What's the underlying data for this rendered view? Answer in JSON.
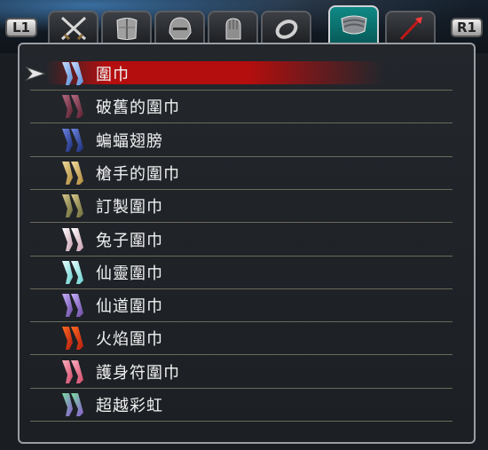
{
  "shoulder_buttons": {
    "left": "L1",
    "right": "R1"
  },
  "tabs": [
    {
      "icon": "crossed-swords-icon",
      "active": false
    },
    {
      "icon": "chest-armor-icon",
      "active": false
    },
    {
      "icon": "helmet-icon",
      "active": false
    },
    {
      "icon": "gauntlet-icon",
      "active": false
    },
    {
      "icon": "ring-icon",
      "active": false
    },
    {
      "icon": "scarf-icon",
      "active": true
    },
    {
      "icon": "crystal-wand-icon",
      "active": false
    }
  ],
  "items": [
    {
      "label": "圍巾",
      "icon": "scarf-icon",
      "colors": [
        "#5b8fd6",
        "#c5dcff"
      ],
      "selected": true
    },
    {
      "label": "破舊的圍巾",
      "icon": "scarf-icon",
      "colors": [
        "#5a1f2e",
        "#b56a84"
      ],
      "selected": false
    },
    {
      "label": "蝙蝠翅膀",
      "icon": "bat-wings-icon",
      "colors": [
        "#1b2c7a",
        "#6e86e0"
      ],
      "selected": false
    },
    {
      "label": "槍手的圍巾",
      "icon": "scarf-icon",
      "colors": [
        "#b08a3a",
        "#f0dca0"
      ],
      "selected": false
    },
    {
      "label": "訂製圍巾",
      "icon": "scarf-icon",
      "colors": [
        "#6a6a3a",
        "#d8c88a"
      ],
      "selected": false
    },
    {
      "label": "兔子圍巾",
      "icon": "scarf-icon",
      "colors": [
        "#c8a0b0",
        "#ffffff"
      ],
      "selected": false
    },
    {
      "label": "仙靈圍巾",
      "icon": "fairy-scarf-icon",
      "colors": [
        "#6ad0d0",
        "#eaffff"
      ],
      "selected": false
    },
    {
      "label": "仙道圍巾",
      "icon": "scarf-icon",
      "colors": [
        "#6a4aa0",
        "#c8b0ff"
      ],
      "selected": false
    },
    {
      "label": "火焰圍巾",
      "icon": "flame-scarf-icon",
      "colors": [
        "#b41c10",
        "#ff6a20"
      ],
      "selected": false
    },
    {
      "label": "護身符圍巾",
      "icon": "talisman-scarf-icon",
      "colors": [
        "#d04a6a",
        "#ffb0c0"
      ],
      "selected": false
    },
    {
      "label": "超越彩虹",
      "icon": "rainbow-scarf-icon",
      "colors": [
        "#8a5ad0",
        "#7ae0a0"
      ],
      "selected": false
    }
  ]
}
